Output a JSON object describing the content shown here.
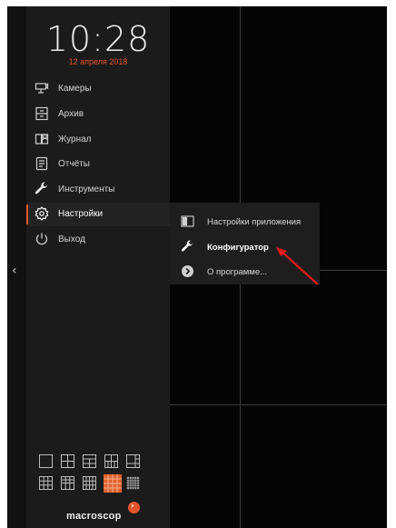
{
  "clock": {
    "time": "10:28",
    "date": "12 апреля 2018"
  },
  "sidebar": {
    "items": [
      {
        "label": "Камеры",
        "icon": "camera-icon"
      },
      {
        "label": "Архив",
        "icon": "archive-icon"
      },
      {
        "label": "Журнал",
        "icon": "journal-icon"
      },
      {
        "label": "Отчёты",
        "icon": "report-icon"
      },
      {
        "label": "Инструменты",
        "icon": "wrench-icon"
      },
      {
        "label": "Настройки",
        "icon": "gear-icon"
      },
      {
        "label": "Выход",
        "icon": "power-icon"
      }
    ],
    "active_item": "Настройки",
    "collapse_icon": "chevron-left-icon"
  },
  "submenu": {
    "items": [
      {
        "label": "Настройки приложения",
        "icon": "app-settings-icon"
      },
      {
        "label": "Конфигуратор",
        "icon": "wrench-icon"
      },
      {
        "label": "О программе...",
        "icon": "chevron-circle-icon"
      }
    ],
    "highlighted_item": "Конфигуратор"
  },
  "layouts": {
    "options": [
      "1x1",
      "2x2",
      "2x2-wide",
      "3x3-mixed",
      "1+5",
      "3x3",
      "3x2",
      "4x3",
      "4x4",
      "5x5"
    ],
    "selected": "4x4"
  },
  "brand": {
    "name": "macroscop",
    "accent_color": "#e2552b"
  },
  "colors": {
    "background": "#050505",
    "sidebar": "#1b1b1b",
    "accent": "#e2552b"
  }
}
